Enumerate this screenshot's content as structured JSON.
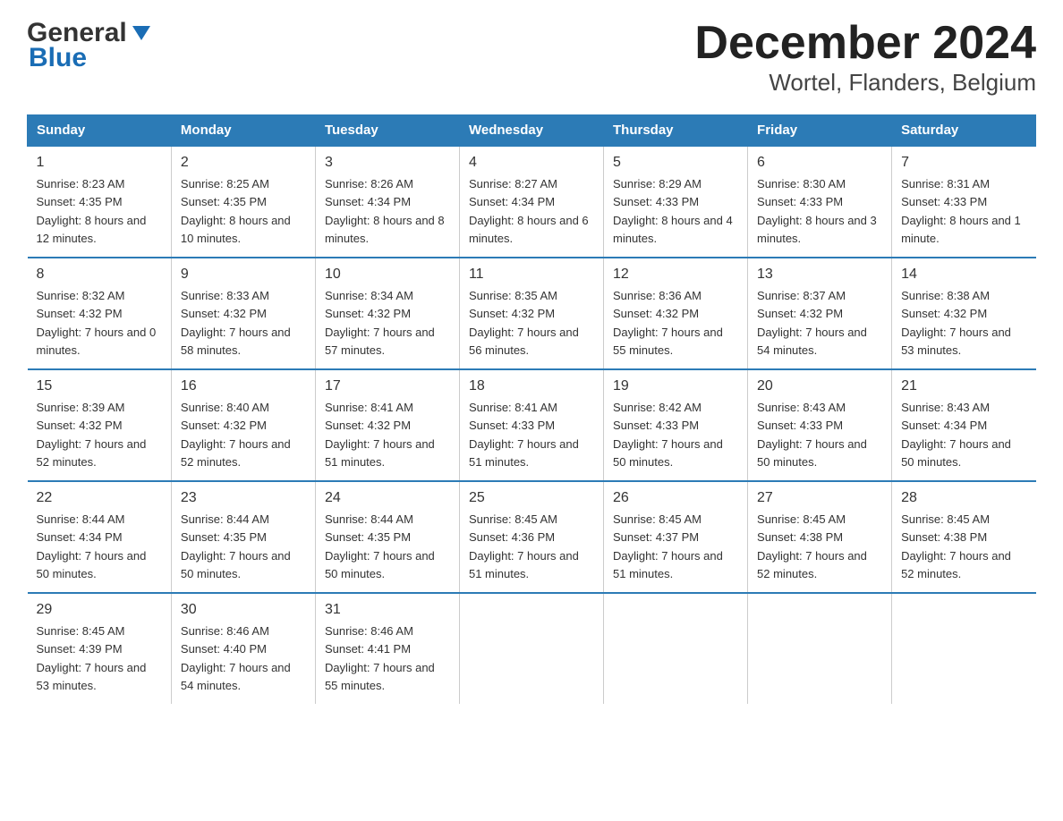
{
  "header": {
    "logo_general": "General",
    "logo_blue": "Blue",
    "title": "December 2024",
    "subtitle": "Wortel, Flanders, Belgium"
  },
  "days_of_week": [
    "Sunday",
    "Monday",
    "Tuesday",
    "Wednesday",
    "Thursday",
    "Friday",
    "Saturday"
  ],
  "weeks": [
    [
      {
        "day": "1",
        "sunrise": "8:23 AM",
        "sunset": "4:35 PM",
        "daylight": "8 hours and 12 minutes."
      },
      {
        "day": "2",
        "sunrise": "8:25 AM",
        "sunset": "4:35 PM",
        "daylight": "8 hours and 10 minutes."
      },
      {
        "day": "3",
        "sunrise": "8:26 AM",
        "sunset": "4:34 PM",
        "daylight": "8 hours and 8 minutes."
      },
      {
        "day": "4",
        "sunrise": "8:27 AM",
        "sunset": "4:34 PM",
        "daylight": "8 hours and 6 minutes."
      },
      {
        "day": "5",
        "sunrise": "8:29 AM",
        "sunset": "4:33 PM",
        "daylight": "8 hours and 4 minutes."
      },
      {
        "day": "6",
        "sunrise": "8:30 AM",
        "sunset": "4:33 PM",
        "daylight": "8 hours and 3 minutes."
      },
      {
        "day": "7",
        "sunrise": "8:31 AM",
        "sunset": "4:33 PM",
        "daylight": "8 hours and 1 minute."
      }
    ],
    [
      {
        "day": "8",
        "sunrise": "8:32 AM",
        "sunset": "4:32 PM",
        "daylight": "7 hours and 0 minutes."
      },
      {
        "day": "9",
        "sunrise": "8:33 AM",
        "sunset": "4:32 PM",
        "daylight": "7 hours and 58 minutes."
      },
      {
        "day": "10",
        "sunrise": "8:34 AM",
        "sunset": "4:32 PM",
        "daylight": "7 hours and 57 minutes."
      },
      {
        "day": "11",
        "sunrise": "8:35 AM",
        "sunset": "4:32 PM",
        "daylight": "7 hours and 56 minutes."
      },
      {
        "day": "12",
        "sunrise": "8:36 AM",
        "sunset": "4:32 PM",
        "daylight": "7 hours and 55 minutes."
      },
      {
        "day": "13",
        "sunrise": "8:37 AM",
        "sunset": "4:32 PM",
        "daylight": "7 hours and 54 minutes."
      },
      {
        "day": "14",
        "sunrise": "8:38 AM",
        "sunset": "4:32 PM",
        "daylight": "7 hours and 53 minutes."
      }
    ],
    [
      {
        "day": "15",
        "sunrise": "8:39 AM",
        "sunset": "4:32 PM",
        "daylight": "7 hours and 52 minutes."
      },
      {
        "day": "16",
        "sunrise": "8:40 AM",
        "sunset": "4:32 PM",
        "daylight": "7 hours and 52 minutes."
      },
      {
        "day": "17",
        "sunrise": "8:41 AM",
        "sunset": "4:32 PM",
        "daylight": "7 hours and 51 minutes."
      },
      {
        "day": "18",
        "sunrise": "8:41 AM",
        "sunset": "4:33 PM",
        "daylight": "7 hours and 51 minutes."
      },
      {
        "day": "19",
        "sunrise": "8:42 AM",
        "sunset": "4:33 PM",
        "daylight": "7 hours and 50 minutes."
      },
      {
        "day": "20",
        "sunrise": "8:43 AM",
        "sunset": "4:33 PM",
        "daylight": "7 hours and 50 minutes."
      },
      {
        "day": "21",
        "sunrise": "8:43 AM",
        "sunset": "4:34 PM",
        "daylight": "7 hours and 50 minutes."
      }
    ],
    [
      {
        "day": "22",
        "sunrise": "8:44 AM",
        "sunset": "4:34 PM",
        "daylight": "7 hours and 50 minutes."
      },
      {
        "day": "23",
        "sunrise": "8:44 AM",
        "sunset": "4:35 PM",
        "daylight": "7 hours and 50 minutes."
      },
      {
        "day": "24",
        "sunrise": "8:44 AM",
        "sunset": "4:35 PM",
        "daylight": "7 hours and 50 minutes."
      },
      {
        "day": "25",
        "sunrise": "8:45 AM",
        "sunset": "4:36 PM",
        "daylight": "7 hours and 51 minutes."
      },
      {
        "day": "26",
        "sunrise": "8:45 AM",
        "sunset": "4:37 PM",
        "daylight": "7 hours and 51 minutes."
      },
      {
        "day": "27",
        "sunrise": "8:45 AM",
        "sunset": "4:38 PM",
        "daylight": "7 hours and 52 minutes."
      },
      {
        "day": "28",
        "sunrise": "8:45 AM",
        "sunset": "4:38 PM",
        "daylight": "7 hours and 52 minutes."
      }
    ],
    [
      {
        "day": "29",
        "sunrise": "8:45 AM",
        "sunset": "4:39 PM",
        "daylight": "7 hours and 53 minutes."
      },
      {
        "day": "30",
        "sunrise": "8:46 AM",
        "sunset": "4:40 PM",
        "daylight": "7 hours and 54 minutes."
      },
      {
        "day": "31",
        "sunrise": "8:46 AM",
        "sunset": "4:41 PM",
        "daylight": "7 hours and 55 minutes."
      },
      null,
      null,
      null,
      null
    ]
  ],
  "labels": {
    "sunrise": "Sunrise:",
    "sunset": "Sunset:",
    "daylight": "Daylight:"
  }
}
